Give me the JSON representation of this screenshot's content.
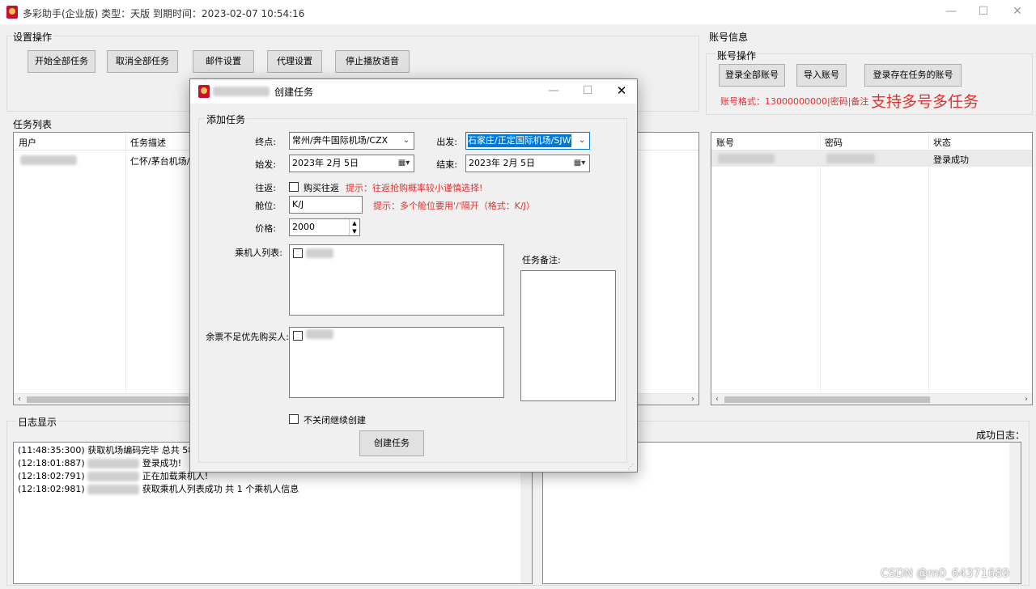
{
  "window": {
    "title": "多彩助手(企业版) 类型：天版 到期时间：2023-02-07 10:54:16",
    "controls": [
      "—",
      "☐",
      "✕"
    ]
  },
  "settings": {
    "group_title": "设置操作",
    "buttons": [
      "开始全部任务",
      "取消全部任务",
      "邮件设置",
      "代理设置",
      "停止播放语音"
    ]
  },
  "tasks": {
    "group_title": "任务列表",
    "columns": [
      "用户",
      "任务描述"
    ],
    "rows": [
      {
        "desc": "仁怀/茅台机场/"
      }
    ]
  },
  "account": {
    "group_title": "账号信息",
    "sub_title": "账号操作",
    "buttons": [
      "登录全部账号",
      "导入账号",
      "登录存在任务的账号"
    ],
    "format_hint": "账号格式：13000000000|密码|备注",
    "promo": "支持多号多任务",
    "columns": [
      "账号",
      "密码",
      "状态"
    ],
    "rows": [
      {
        "status": "登录成功"
      }
    ]
  },
  "log": {
    "group_title": "日志显示",
    "success_title": "成功日志：",
    "lines": [
      {
        "time": "(11:48:35:300)",
        "msg": "获取机场编码完毕 总共 58"
      },
      {
        "time": "(12:18:01:887)",
        "msg": "登录成功!"
      },
      {
        "time": "(12:18:02:791)",
        "msg": "正在加载乘机人!"
      },
      {
        "time": "(12:18:02:981)",
        "msg": "获取乘机人列表成功 共 1 个乘机人信息"
      }
    ]
  },
  "dialog": {
    "title": "创建任务",
    "controls": [
      "—",
      "☐",
      "✕"
    ],
    "group_title": "添加任务",
    "dest_label": "终点:",
    "dest_value": "常州/奔牛国际机场/CZX",
    "origin_label": "出发:",
    "origin_value": "石家庄/正定国际机场/SJW",
    "start_label": "始发:",
    "start_value": "2023年  2月  5日",
    "end_label": "结束:",
    "end_value": "2023年  2月  5日",
    "round_label": "往返:",
    "round_checkbox": "购买往返",
    "round_hint": "提示：往返抢购概率较小谨慎选择!",
    "cabin_label": "舱位:",
    "cabin_value": "K/J",
    "cabin_hint": "提示：多个舱位要用'/'隔开（格式：K/J）",
    "price_label": "价格:",
    "price_value": "2000",
    "passenger_label": "乘机人列表:",
    "priority_label": "余票不足优先购买人:",
    "note_label": "任务备注:",
    "keep_open": "不关闭继续创建",
    "create_button": "创建任务"
  },
  "watermark": "CSDN @m0_64371689",
  "colors": {
    "red": "#e0302e",
    "selection": "#0078d7"
  }
}
